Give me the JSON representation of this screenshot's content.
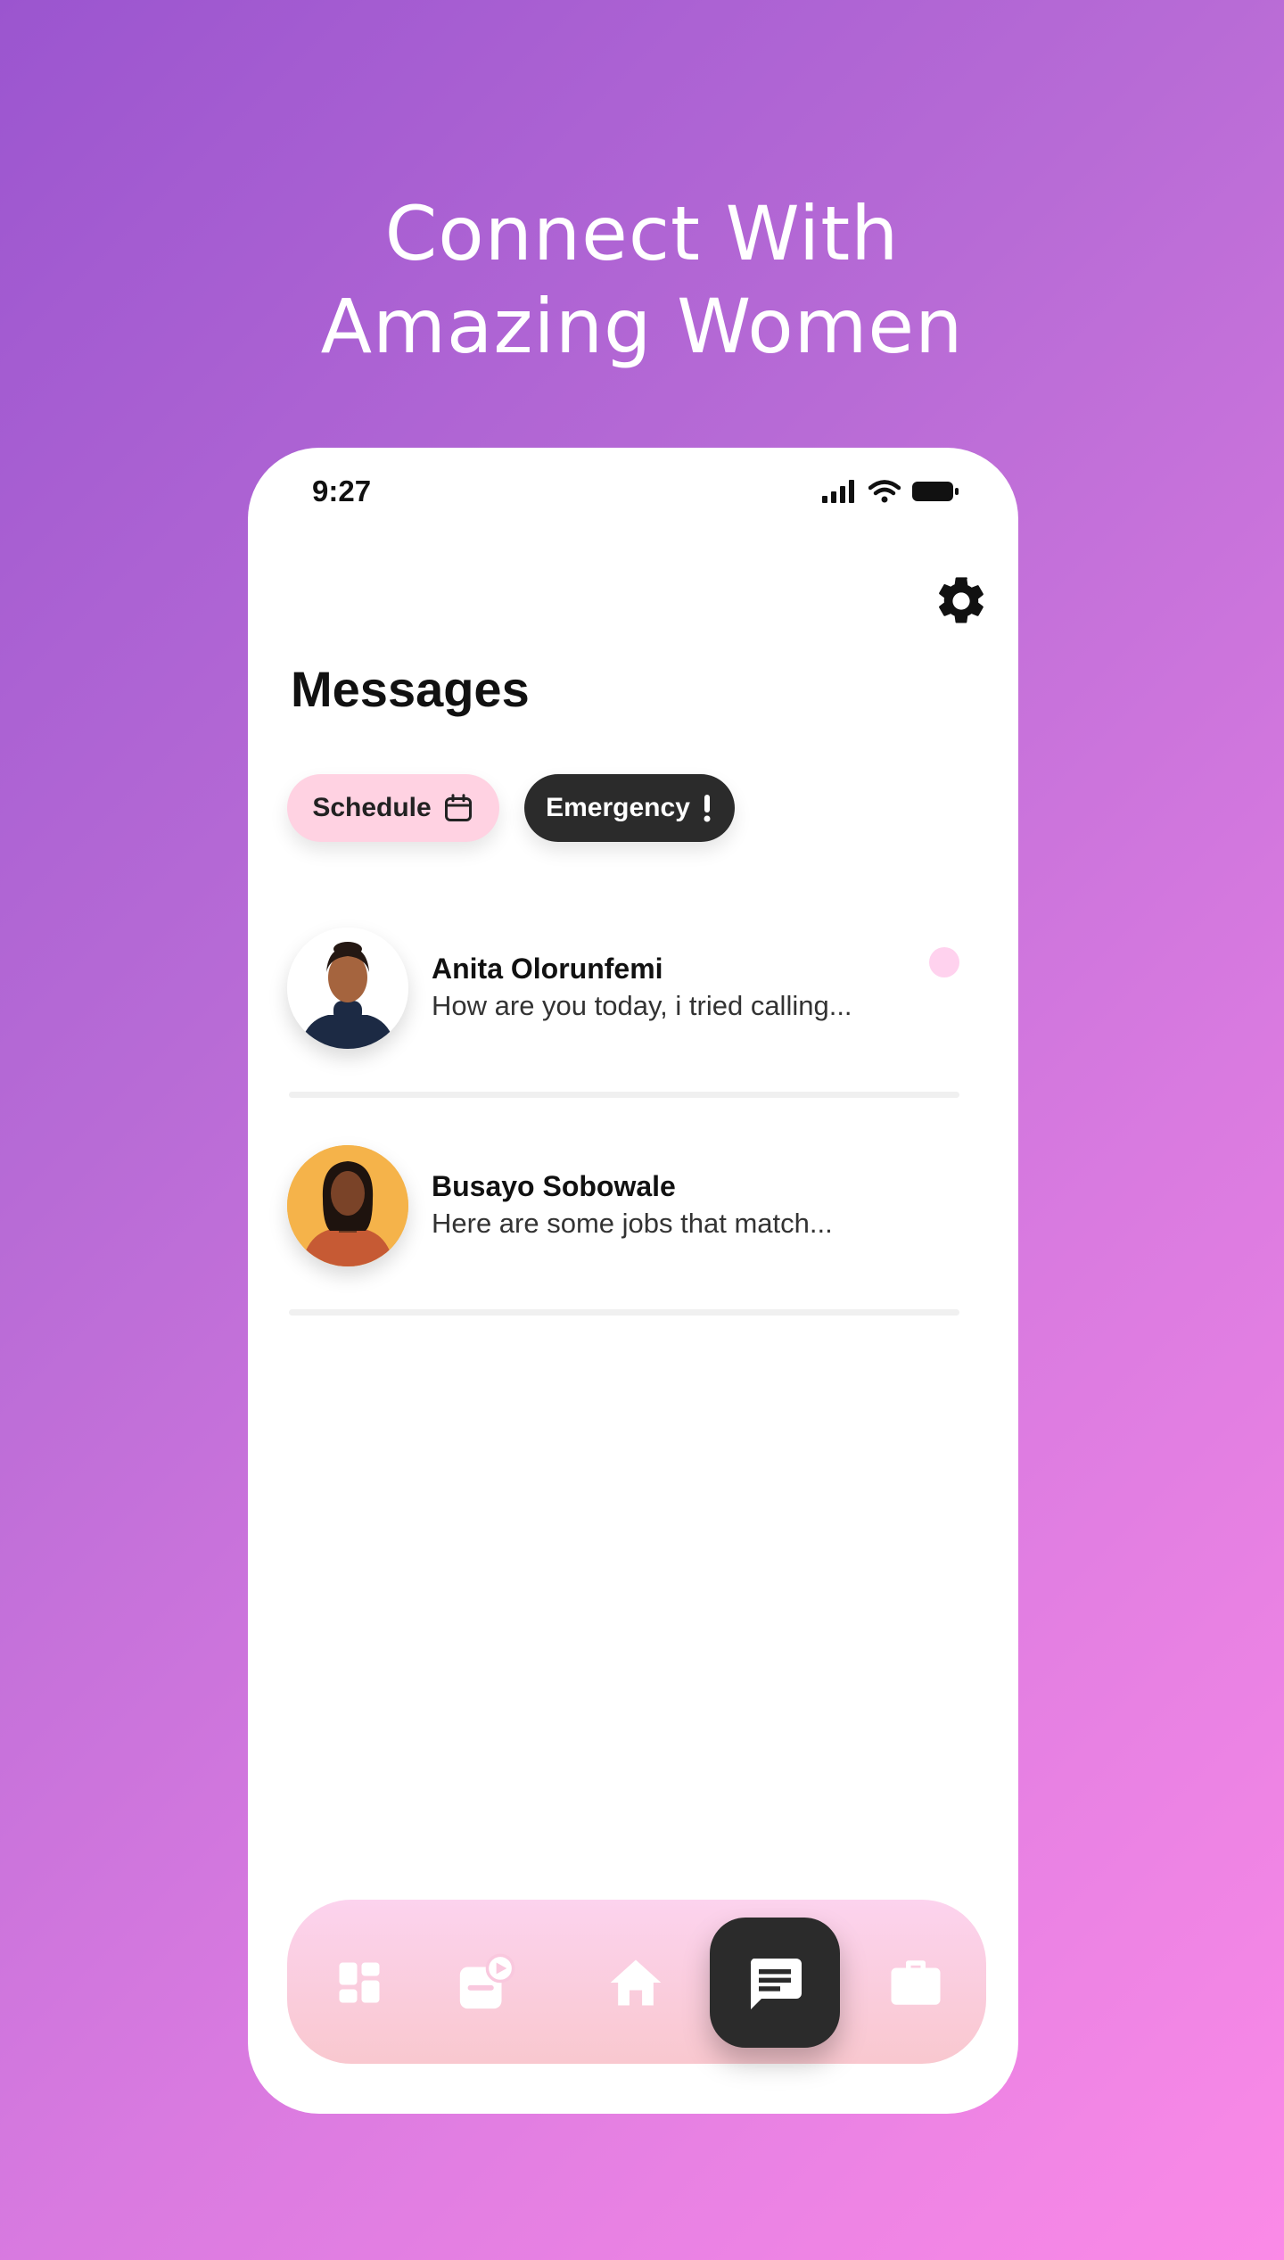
{
  "headline": {
    "line1": "Connect With",
    "line2": "Amazing Women"
  },
  "status_bar": {
    "time": "9:27"
  },
  "page": {
    "title": "Messages"
  },
  "chips": [
    {
      "label": "Schedule",
      "icon": "calendar-icon"
    },
    {
      "label": "Emergency",
      "icon": "exclamation-icon"
    }
  ],
  "messages": [
    {
      "name": "Anita Olorunfemi",
      "preview": "How are you today, i tried calling...",
      "unread": true
    },
    {
      "name": "Busayo Sobowale",
      "preview": "Here are some jobs that match...",
      "unread": false
    }
  ],
  "nav": [
    {
      "icon": "dashboard-icon",
      "active": false
    },
    {
      "icon": "video-library-icon",
      "active": false
    },
    {
      "icon": "home-icon",
      "active": false
    },
    {
      "icon": "chat-icon",
      "active": true
    },
    {
      "icon": "briefcase-icon",
      "active": false
    }
  ],
  "colors": {
    "bg_start": "#9b55cf",
    "bg_end": "#fb8ae7",
    "chip_schedule": "#ffd2e2",
    "chip_emergency": "#2b2b2b",
    "nav_bg": "#fcd3ee",
    "unread_dot": "#ffd2ee"
  }
}
